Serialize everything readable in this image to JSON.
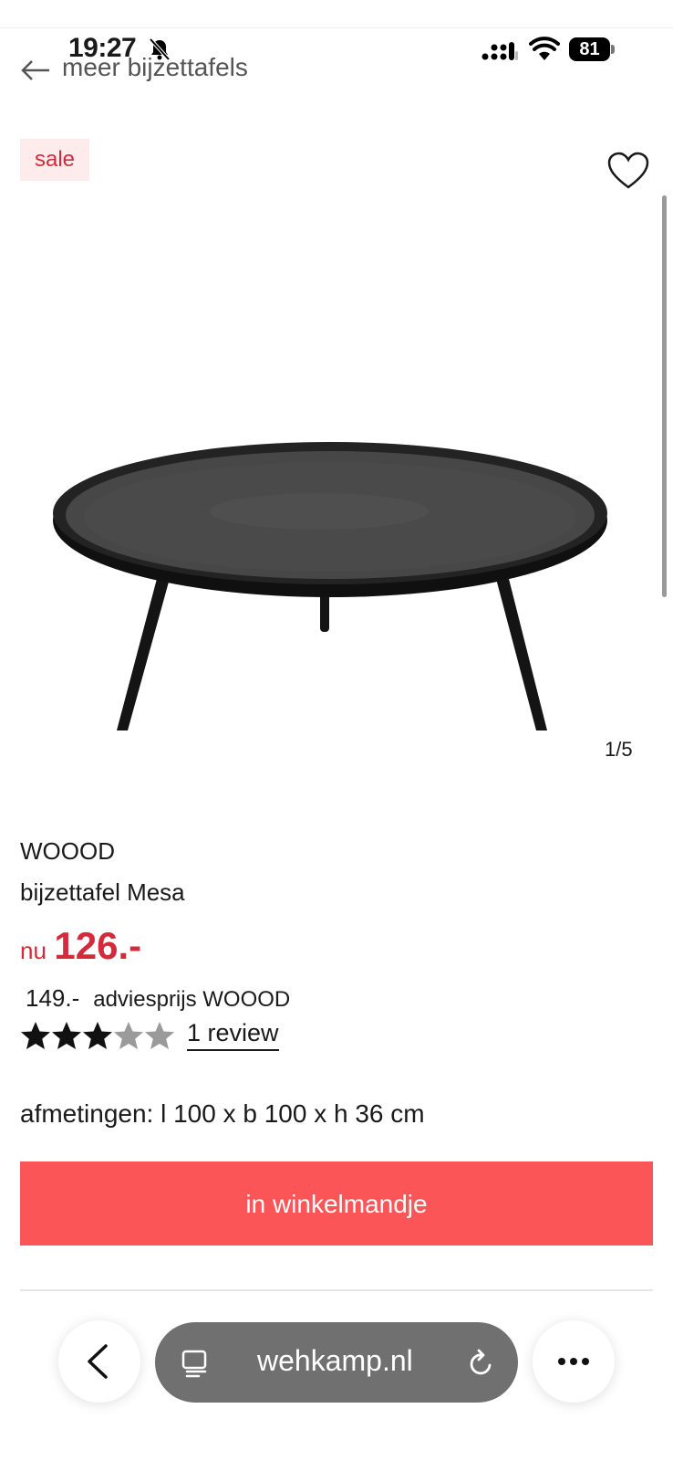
{
  "status_bar": {
    "time": "19:27",
    "battery": "81",
    "icons": [
      "bell-slash-icon",
      "signal-icon",
      "wifi-icon",
      "battery-icon"
    ]
  },
  "nav": {
    "back_label": "meer bijzettafels"
  },
  "product": {
    "badge": "sale",
    "image_counter": "1/5",
    "brand": "WOOOD",
    "title": "bijzettafel Mesa",
    "price_prefix": "nu",
    "price": "126.-",
    "advice_price": "149.-",
    "advice_label": "adviesprijs WOOOD",
    "rating": 3,
    "rating_max": 5,
    "review_label": "1 review",
    "dimensions": "afmetingen: l 100 x b 100 x h 36 cm",
    "cart_button": "in winkelmandje"
  },
  "browser": {
    "url": "wehkamp.nl"
  },
  "colors": {
    "accent": "#fb5558",
    "sale_red": "#d32b3c",
    "sale_bg": "#fdeceb"
  }
}
